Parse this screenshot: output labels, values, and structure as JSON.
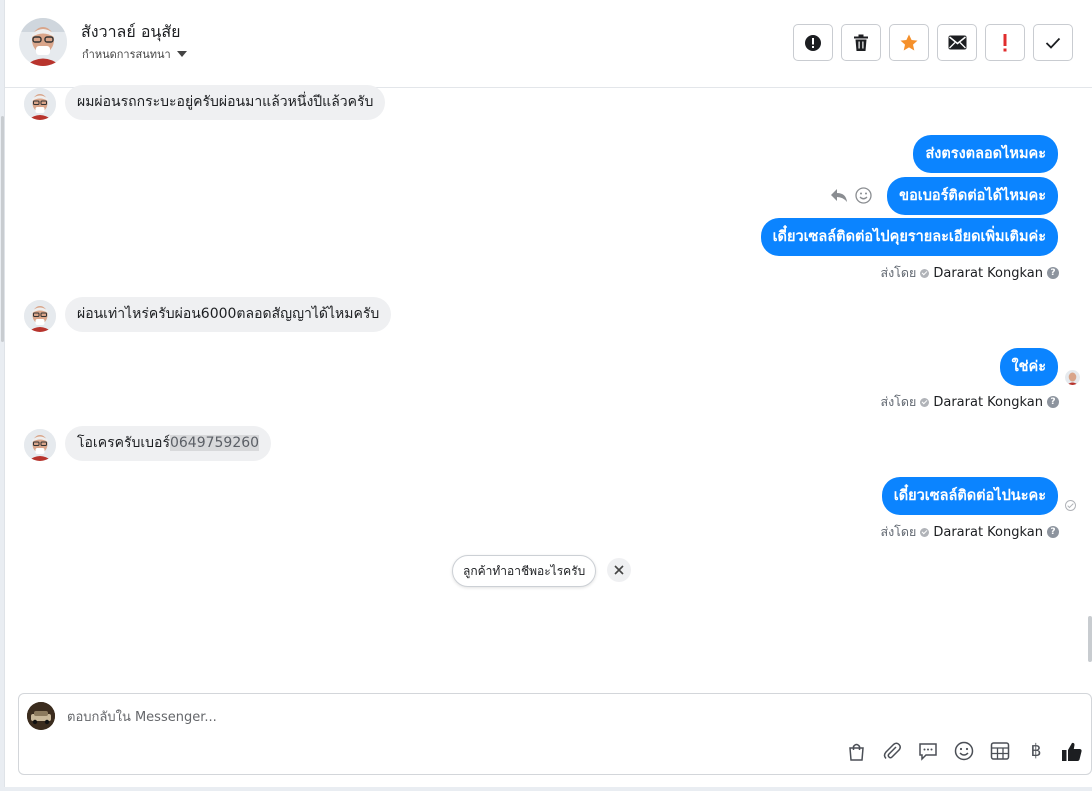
{
  "header": {
    "contact_name": "สังวาลย์ อนุสัย",
    "assign_label": "กำหนดการสนทนา",
    "actions": [
      {
        "name": "spam-button",
        "icon": "alert-circle-icon"
      },
      {
        "name": "delete-button",
        "icon": "trash-icon"
      },
      {
        "name": "star-button",
        "icon": "star-icon"
      },
      {
        "name": "mark-unread-button",
        "icon": "envelope-icon"
      },
      {
        "name": "follow-up-button",
        "icon": "exclamation-icon"
      },
      {
        "name": "mark-done-button",
        "icon": "checkmark-icon"
      }
    ]
  },
  "messages": {
    "m1": "ผมผ่อนรถกระบะอยู่ครับผ่อนมาแล้วหนึ่งปีแล้วครับ",
    "m2": "ส่งตรงตลอดไหมคะ",
    "m3": "ขอเบอร์ติดต่อได้ไหมคะ",
    "m4": "เดี๋ยวเซลล์ติดต่อไปคุยรายละเอียดเพิ่มเติมค่ะ",
    "m5": "ผ่อนเท่าไหร่ครับผ่อน6000ตลอดสัญญาได้ไหมครับ",
    "m6": "ใช่ค่ะ",
    "m7_prefix": "โอเครครับเบอร์",
    "m7_phone": "0649759260",
    "m8": "เดี๋ยวเซลล์ติดต่อไปนะคะ"
  },
  "sent_by": {
    "label": "ส่งโดย",
    "agent": "Dararat Kongkan",
    "help": "?"
  },
  "suggestion": {
    "text": "ลูกค้าทำอาชีพอะไรครับ",
    "close": "✕"
  },
  "composer": {
    "placeholder": "ตอบกลับใน Messenger...",
    "tools": [
      "shopping-bag-icon",
      "paperclip-icon",
      "saved-reply-icon",
      "emoji-icon",
      "table-icon",
      "baht-icon",
      "like-icon"
    ],
    "baht_symbol": "฿"
  },
  "colors": {
    "outgoing_bubble": "#0b84ff",
    "incoming_bubble": "#eff0f2",
    "star": "#f5902b",
    "follow_up": "#e02d2d"
  }
}
